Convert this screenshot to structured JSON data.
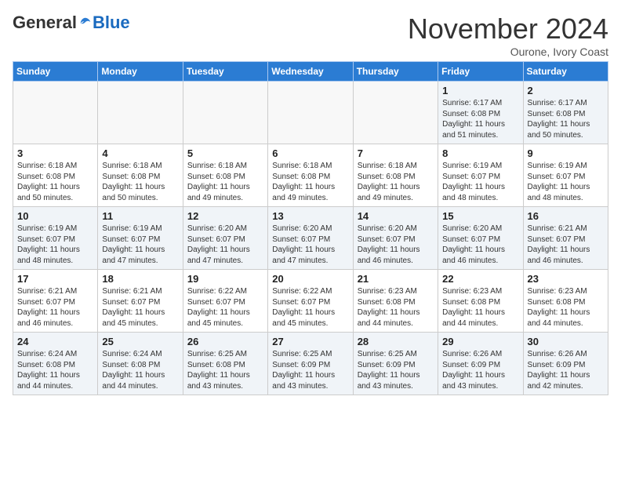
{
  "header": {
    "logo_general": "General",
    "logo_blue": "Blue",
    "month_title": "November 2024",
    "location": "Ourone, Ivory Coast"
  },
  "days_of_week": [
    "Sunday",
    "Monday",
    "Tuesday",
    "Wednesday",
    "Thursday",
    "Friday",
    "Saturday"
  ],
  "weeks": [
    [
      {
        "day": "",
        "info": "",
        "empty": true
      },
      {
        "day": "",
        "info": "",
        "empty": true
      },
      {
        "day": "",
        "info": "",
        "empty": true
      },
      {
        "day": "",
        "info": "",
        "empty": true
      },
      {
        "day": "",
        "info": "",
        "empty": true
      },
      {
        "day": "1",
        "info": "Sunrise: 6:17 AM\nSunset: 6:08 PM\nDaylight: 11 hours\nand 51 minutes.",
        "empty": false
      },
      {
        "day": "2",
        "info": "Sunrise: 6:17 AM\nSunset: 6:08 PM\nDaylight: 11 hours\nand 50 minutes.",
        "empty": false
      }
    ],
    [
      {
        "day": "3",
        "info": "Sunrise: 6:18 AM\nSunset: 6:08 PM\nDaylight: 11 hours\nand 50 minutes.",
        "empty": false
      },
      {
        "day": "4",
        "info": "Sunrise: 6:18 AM\nSunset: 6:08 PM\nDaylight: 11 hours\nand 50 minutes.",
        "empty": false
      },
      {
        "day": "5",
        "info": "Sunrise: 6:18 AM\nSunset: 6:08 PM\nDaylight: 11 hours\nand 49 minutes.",
        "empty": false
      },
      {
        "day": "6",
        "info": "Sunrise: 6:18 AM\nSunset: 6:08 PM\nDaylight: 11 hours\nand 49 minutes.",
        "empty": false
      },
      {
        "day": "7",
        "info": "Sunrise: 6:18 AM\nSunset: 6:08 PM\nDaylight: 11 hours\nand 49 minutes.",
        "empty": false
      },
      {
        "day": "8",
        "info": "Sunrise: 6:19 AM\nSunset: 6:07 PM\nDaylight: 11 hours\nand 48 minutes.",
        "empty": false
      },
      {
        "day": "9",
        "info": "Sunrise: 6:19 AM\nSunset: 6:07 PM\nDaylight: 11 hours\nand 48 minutes.",
        "empty": false
      }
    ],
    [
      {
        "day": "10",
        "info": "Sunrise: 6:19 AM\nSunset: 6:07 PM\nDaylight: 11 hours\nand 48 minutes.",
        "empty": false
      },
      {
        "day": "11",
        "info": "Sunrise: 6:19 AM\nSunset: 6:07 PM\nDaylight: 11 hours\nand 47 minutes.",
        "empty": false
      },
      {
        "day": "12",
        "info": "Sunrise: 6:20 AM\nSunset: 6:07 PM\nDaylight: 11 hours\nand 47 minutes.",
        "empty": false
      },
      {
        "day": "13",
        "info": "Sunrise: 6:20 AM\nSunset: 6:07 PM\nDaylight: 11 hours\nand 47 minutes.",
        "empty": false
      },
      {
        "day": "14",
        "info": "Sunrise: 6:20 AM\nSunset: 6:07 PM\nDaylight: 11 hours\nand 46 minutes.",
        "empty": false
      },
      {
        "day": "15",
        "info": "Sunrise: 6:20 AM\nSunset: 6:07 PM\nDaylight: 11 hours\nand 46 minutes.",
        "empty": false
      },
      {
        "day": "16",
        "info": "Sunrise: 6:21 AM\nSunset: 6:07 PM\nDaylight: 11 hours\nand 46 minutes.",
        "empty": false
      }
    ],
    [
      {
        "day": "17",
        "info": "Sunrise: 6:21 AM\nSunset: 6:07 PM\nDaylight: 11 hours\nand 46 minutes.",
        "empty": false
      },
      {
        "day": "18",
        "info": "Sunrise: 6:21 AM\nSunset: 6:07 PM\nDaylight: 11 hours\nand 45 minutes.",
        "empty": false
      },
      {
        "day": "19",
        "info": "Sunrise: 6:22 AM\nSunset: 6:07 PM\nDaylight: 11 hours\nand 45 minutes.",
        "empty": false
      },
      {
        "day": "20",
        "info": "Sunrise: 6:22 AM\nSunset: 6:07 PM\nDaylight: 11 hours\nand 45 minutes.",
        "empty": false
      },
      {
        "day": "21",
        "info": "Sunrise: 6:23 AM\nSunset: 6:08 PM\nDaylight: 11 hours\nand 44 minutes.",
        "empty": false
      },
      {
        "day": "22",
        "info": "Sunrise: 6:23 AM\nSunset: 6:08 PM\nDaylight: 11 hours\nand 44 minutes.",
        "empty": false
      },
      {
        "day": "23",
        "info": "Sunrise: 6:23 AM\nSunset: 6:08 PM\nDaylight: 11 hours\nand 44 minutes.",
        "empty": false
      }
    ],
    [
      {
        "day": "24",
        "info": "Sunrise: 6:24 AM\nSunset: 6:08 PM\nDaylight: 11 hours\nand 44 minutes.",
        "empty": false
      },
      {
        "day": "25",
        "info": "Sunrise: 6:24 AM\nSunset: 6:08 PM\nDaylight: 11 hours\nand 44 minutes.",
        "empty": false
      },
      {
        "day": "26",
        "info": "Sunrise: 6:25 AM\nSunset: 6:08 PM\nDaylight: 11 hours\nand 43 minutes.",
        "empty": false
      },
      {
        "day": "27",
        "info": "Sunrise: 6:25 AM\nSunset: 6:09 PM\nDaylight: 11 hours\nand 43 minutes.",
        "empty": false
      },
      {
        "day": "28",
        "info": "Sunrise: 6:25 AM\nSunset: 6:09 PM\nDaylight: 11 hours\nand 43 minutes.",
        "empty": false
      },
      {
        "day": "29",
        "info": "Sunrise: 6:26 AM\nSunset: 6:09 PM\nDaylight: 11 hours\nand 43 minutes.",
        "empty": false
      },
      {
        "day": "30",
        "info": "Sunrise: 6:26 AM\nSunset: 6:09 PM\nDaylight: 11 hours\nand 42 minutes.",
        "empty": false
      }
    ]
  ]
}
